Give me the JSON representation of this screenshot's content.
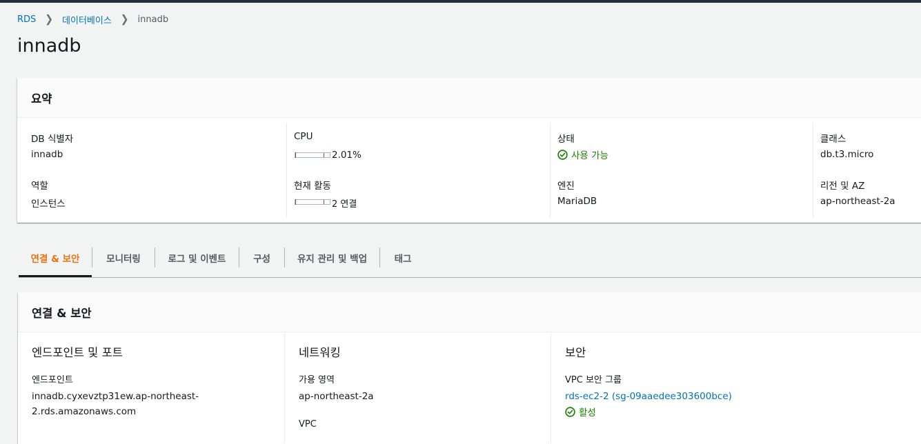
{
  "breadcrumb": {
    "items": [
      "RDS",
      "데이터베이스"
    ],
    "current": "innadb"
  },
  "page": {
    "title": "innadb"
  },
  "summary": {
    "header": "요약",
    "db_id_label": "DB 식별자",
    "db_id_value": "innadb",
    "role_label": "역할",
    "role_value": "인스턴스",
    "cpu_label": "CPU",
    "cpu_value": "2.01%",
    "cpu_fraction": 0.0201,
    "activity_label": "현재 활동",
    "activity_value": "2 연결",
    "activity_fraction": 0.02,
    "status_label": "상태",
    "status_value": "사용 가능",
    "engine_label": "엔진",
    "engine_value": "MariaDB",
    "class_label": "클래스",
    "class_value": "db.t3.micro",
    "region_label": "리전 및 AZ",
    "region_value": "ap-northeast-2a"
  },
  "tabs": [
    "연결 & 보안",
    "모니터링",
    "로그 및 이벤트",
    "구성",
    "유지 관리 및 백업",
    "태그"
  ],
  "connectivity": {
    "header": "연결 & 보안",
    "endpoint_section": "엔드포인트 및 포트",
    "endpoint_label": "엔드포인트",
    "endpoint_line1": "innadb.cyxevztp31ew.ap-northeast-",
    "endpoint_line2": "2.rds.amazonaws.com",
    "networking_section": "네트워킹",
    "az_label": "가용 영역",
    "az_value": "ap-northeast-2a",
    "vpc_label": "VPC",
    "security_section": "보안",
    "sg_label": "VPC 보안 그룹",
    "sg_value": "rds-ec2-2 (sg-09aaedee303600bce)",
    "sg_status": "활성"
  },
  "colors": {
    "link": "#0073bb",
    "success": "#1d8102",
    "active_tab": "#ec7211"
  }
}
